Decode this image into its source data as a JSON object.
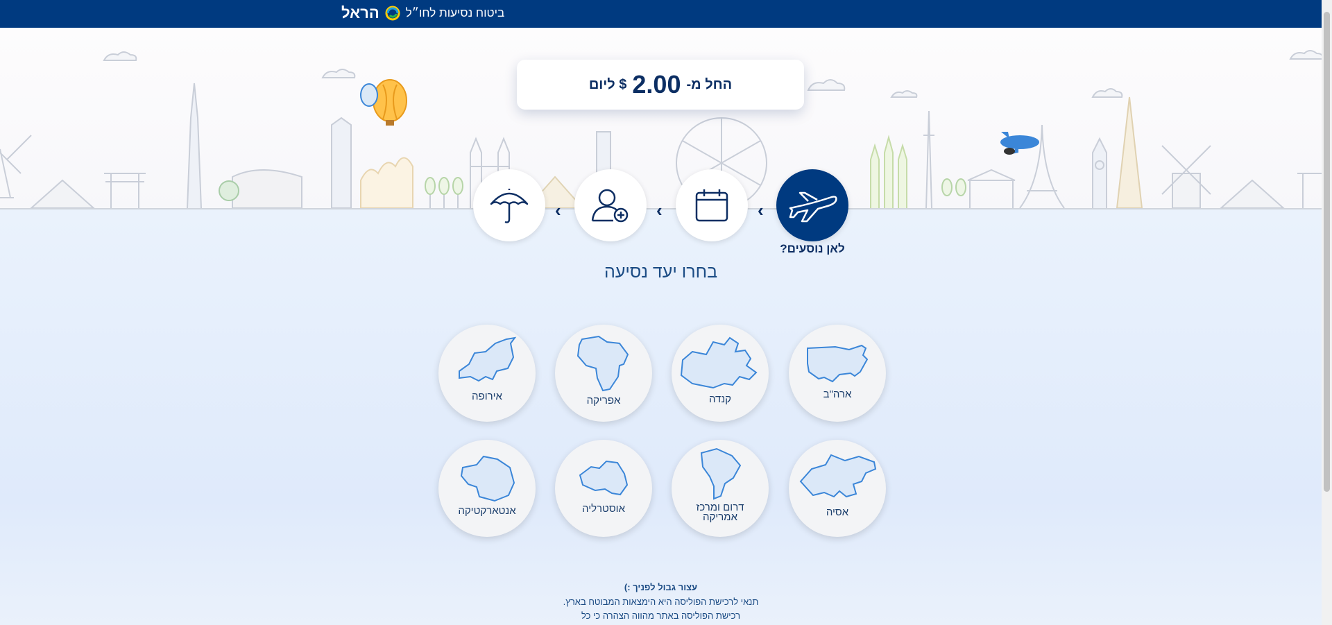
{
  "header": {
    "brand": "הראל",
    "title": "ביטוח נסיעות לחו״ל"
  },
  "price_card": {
    "prefix": "החל מ-",
    "amount": "2.00",
    "suffix": "$ ליום"
  },
  "steps": [
    {
      "name": "destination",
      "icon": "airplane-icon",
      "label": "לאן נוסעים?",
      "active": true
    },
    {
      "name": "dates",
      "icon": "calendar-icon",
      "active": false
    },
    {
      "name": "travelers",
      "icon": "add-user-icon",
      "active": false
    },
    {
      "name": "coverage",
      "icon": "umbrella-icon",
      "active": false
    }
  ],
  "section_title": "בחרו יעד נסיעה",
  "destinations": [
    {
      "label": "ארה\"ב"
    },
    {
      "label": "קנדה"
    },
    {
      "label": "אפריקה"
    },
    {
      "label": "אירופה"
    },
    {
      "label": "אסיה"
    },
    {
      "label": "דרום ומרכז אמריקה"
    },
    {
      "label": "אוסטרליה"
    },
    {
      "label": "אנטארקטיקה"
    }
  ],
  "notice": {
    "title": "עצור גבול לפניך :)",
    "line1": "תנאי לרכישת הפוליסה היא הימצאות המבוטח בארץ.",
    "line2": "רכישת הפוליסה באתר מהווה הצהרה כי כל"
  },
  "colors": {
    "navy": "#003a80",
    "text_dark": "#0d2e63",
    "accent_blue": "#3b86d8"
  }
}
